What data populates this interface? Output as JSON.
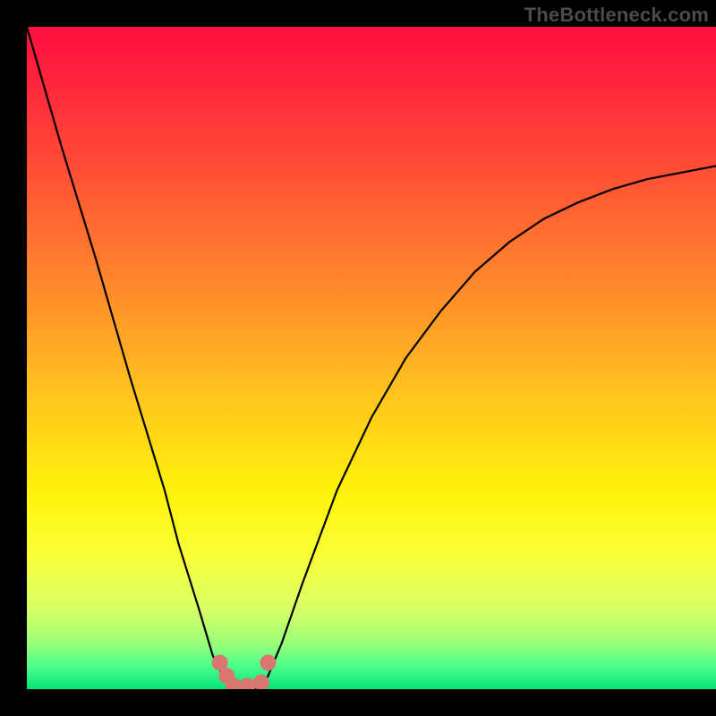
{
  "attribution": "TheBottleneck.com",
  "chart_data": {
    "type": "line",
    "title": "",
    "xlabel": "",
    "ylabel": "",
    "xlim": [
      0,
      100
    ],
    "ylim": [
      0,
      100
    ],
    "x": [
      0,
      5,
      10,
      15,
      20,
      22,
      25,
      27,
      29,
      30,
      31,
      32,
      33,
      34,
      35,
      37,
      40,
      45,
      50,
      55,
      60,
      65,
      70,
      75,
      80,
      85,
      90,
      95,
      100
    ],
    "values": [
      100,
      82,
      65,
      47,
      30,
      22,
      12,
      5,
      1,
      0,
      0,
      0,
      0,
      0.5,
      2,
      7,
      16,
      30,
      41,
      50,
      57,
      63,
      67.5,
      71,
      73.5,
      75.5,
      77,
      78,
      79
    ],
    "minimum_x": 31,
    "annotations": [
      {
        "type": "marker",
        "x": 28,
        "y": 4,
        "color": "#d8776f"
      },
      {
        "type": "marker",
        "x": 29,
        "y": 2,
        "color": "#d8776f"
      },
      {
        "type": "marker",
        "x": 30,
        "y": 0.5,
        "color": "#d8776f"
      },
      {
        "type": "marker",
        "x": 32,
        "y": 0.5,
        "color": "#d8776f"
      },
      {
        "type": "marker",
        "x": 34,
        "y": 1,
        "color": "#d8776f"
      },
      {
        "type": "marker",
        "x": 35,
        "y": 4,
        "color": "#d8776f"
      }
    ],
    "background_gradient": {
      "type": "vertical",
      "stops": [
        {
          "offset": 0.0,
          "color": "#ff0e3e"
        },
        {
          "offset": 0.1,
          "color": "#ff2a3b"
        },
        {
          "offset": 0.25,
          "color": "#ff5a33"
        },
        {
          "offset": 0.4,
          "color": "#ff8c2b"
        },
        {
          "offset": 0.55,
          "color": "#ffc21f"
        },
        {
          "offset": 0.7,
          "color": "#fff20a"
        },
        {
          "offset": 0.8,
          "color": "#faff3a"
        },
        {
          "offset": 0.88,
          "color": "#d7ff66"
        },
        {
          "offset": 0.93,
          "color": "#9cff7a"
        },
        {
          "offset": 0.965,
          "color": "#4dff8a"
        },
        {
          "offset": 1.0,
          "color": "#06e27a"
        }
      ]
    }
  }
}
